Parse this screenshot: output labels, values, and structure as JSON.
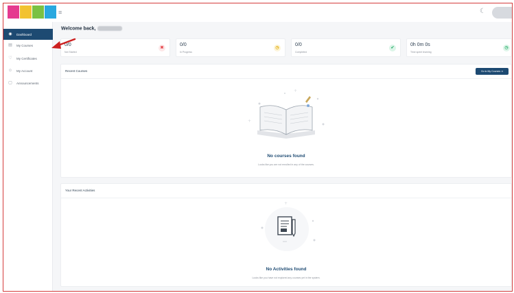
{
  "header": {
    "menu_icon": "hamburger-icon",
    "notification_icon": "bell-icon"
  },
  "sidebar": {
    "items": [
      {
        "label": "Dashboard",
        "icon": "dashboard-icon",
        "active": true
      },
      {
        "label": "My Courses",
        "icon": "book-icon",
        "active": false
      },
      {
        "label": "My Certificates",
        "icon": "certificate-icon",
        "active": false
      },
      {
        "label": "My Account",
        "icon": "user-icon",
        "active": false
      },
      {
        "label": "Announcements",
        "icon": "megaphone-icon",
        "active": false
      }
    ]
  },
  "main": {
    "welcome": "Welcome back,",
    "stats": [
      {
        "value": "0/0",
        "label": "Not Started",
        "badge": "✖",
        "badge_color": "#e5484d",
        "badge_bg": "#fde7e8"
      },
      {
        "value": "0/0",
        "label": "In Progress",
        "badge": "◷",
        "badge_color": "#e0a800",
        "badge_bg": "#fdf4d6"
      },
      {
        "value": "0/0",
        "label": "Completed",
        "badge": "✔",
        "badge_color": "#2fb06f",
        "badge_bg": "#dcf5e8"
      },
      {
        "value": "0h 0m 0s",
        "label": "Time spent learning",
        "badge": "◷",
        "badge_color": "#2fb06f",
        "badge_bg": "#dcf5e8"
      }
    ],
    "recent_courses": {
      "title": "Recent Courses",
      "button": "Go to My Courses ➔",
      "empty_title": "No courses found",
      "empty_sub": "Looks like you are not enrolled in any of the courses."
    },
    "recent_activities": {
      "title": "Your Recent Activities",
      "empty_title": "No Activities found",
      "empty_sub": "Looks like you have not explored any courses yet in the system."
    }
  },
  "colors": {
    "primary": "#1d4a72",
    "annotation_arrow": "#cc1f1f"
  }
}
